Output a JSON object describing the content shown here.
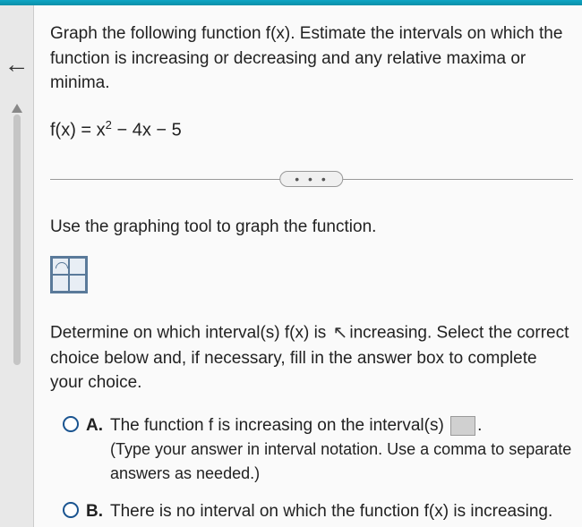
{
  "question": {
    "prompt": "Graph the following function f(x). Estimate the intervals on which the function is increasing or decreasing and any relative maxima or minima.",
    "equation_prefix": "f(x) = x",
    "equation_exp": "2",
    "equation_suffix": " − 4x − 5"
  },
  "ellipsis": "• • •",
  "instruction1": "Use the graphing tool to graph the function.",
  "instruction2_a": "Determine on which interval(s) f(x) is ",
  "instruction2_b": "increasing. Select the correct choice below and, if necessary, fill in the answer box to complete your choice.",
  "choices": {
    "a": {
      "label": "A.",
      "text_before": "The function f is increasing on the interval(s) ",
      "text_after": ".",
      "hint": "(Type your answer in interval notation. Use a comma to separate answers as needed.)"
    },
    "b": {
      "label": "B.",
      "text": "There is no interval on which the function f(x) is increasing."
    }
  }
}
